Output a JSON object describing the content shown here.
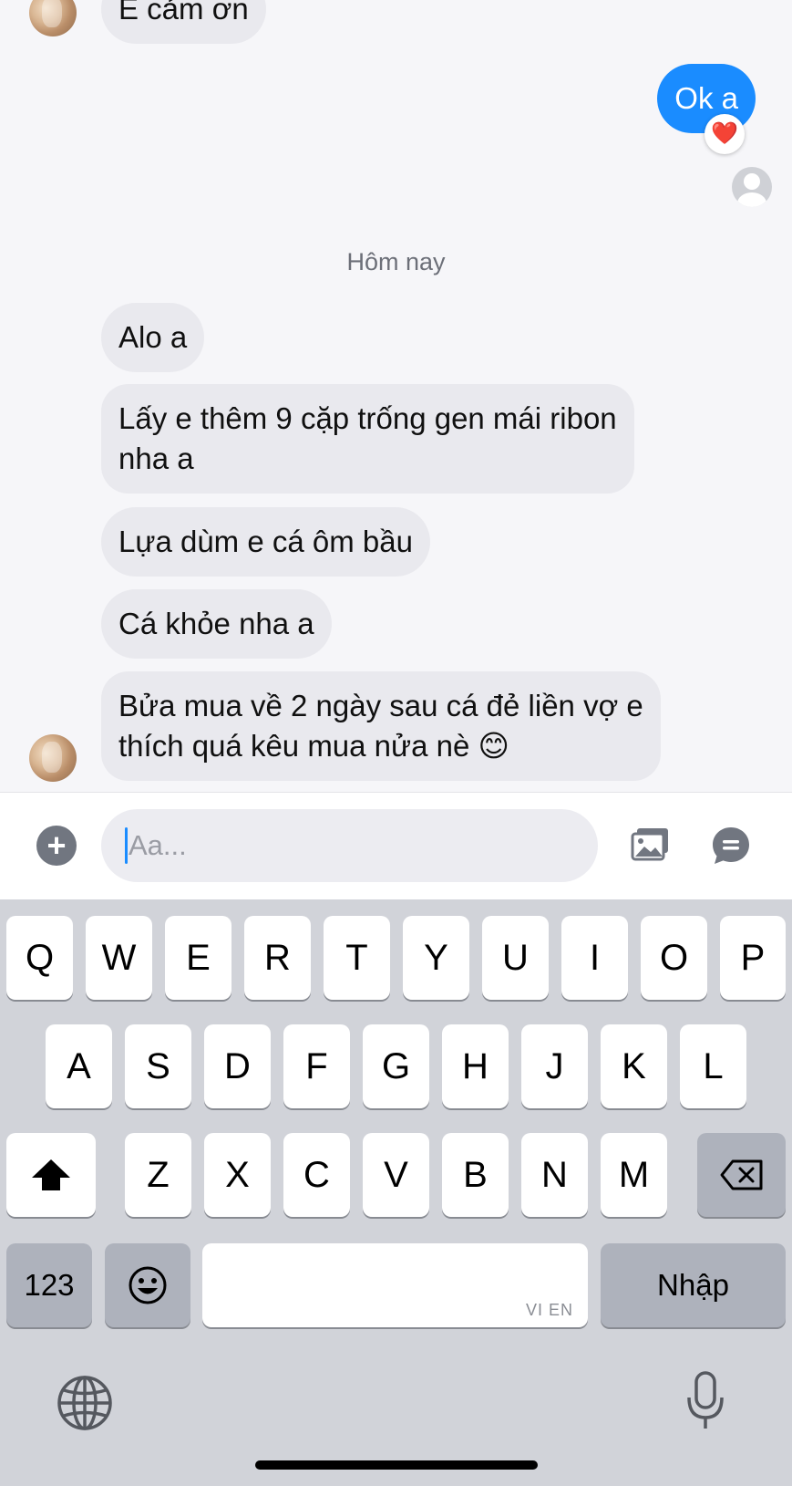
{
  "chat": {
    "top_message": "E cảm ơn",
    "outgoing_message": "Ok a",
    "reaction_emoji": "❤️",
    "day_separator": "Hôm nay",
    "incoming_messages": [
      {
        "line1": "Alo a",
        "line2": ""
      },
      {
        "line1": "Lấy e thêm 9 cặp trống gen mái ribon",
        "line2": "nha a"
      },
      {
        "line1": "Lựa dùm e cá ôm bầu",
        "line2": ""
      },
      {
        "line1": "Cá khỏe nha a",
        "line2": ""
      },
      {
        "line1": "Bửa mua về 2 ngày sau cá đẻ liền vợ e",
        "line2": "thích quá kêu mua nửa nè 😊"
      }
    ]
  },
  "composer": {
    "placeholder": "Aa...",
    "plus_icon": "plus-circle-icon",
    "photo_icon": "photo-gallery-icon",
    "chat_icon": "chat-bubble-icon"
  },
  "keyboard": {
    "row1": [
      "Q",
      "W",
      "E",
      "R",
      "T",
      "Y",
      "U",
      "I",
      "O",
      "P"
    ],
    "row2": [
      "A",
      "S",
      "D",
      "F",
      "G",
      "H",
      "J",
      "K",
      "L"
    ],
    "row3": [
      "Z",
      "X",
      "C",
      "V",
      "B",
      "N",
      "M"
    ],
    "numbers_label": "123",
    "space_sublabel": "VI EN",
    "return_label": "Nhập",
    "shift_icon": "shift-arrow-icon",
    "backspace_icon": "backspace-icon",
    "emoji_icon": "emoji-icon",
    "globe_icon": "globe-icon",
    "mic_icon": "microphone-icon"
  },
  "colors": {
    "outgoing_bubble": "#1a8cff",
    "incoming_bubble": "#e9e9ee",
    "keyboard_bg": "#d1d3d9"
  }
}
